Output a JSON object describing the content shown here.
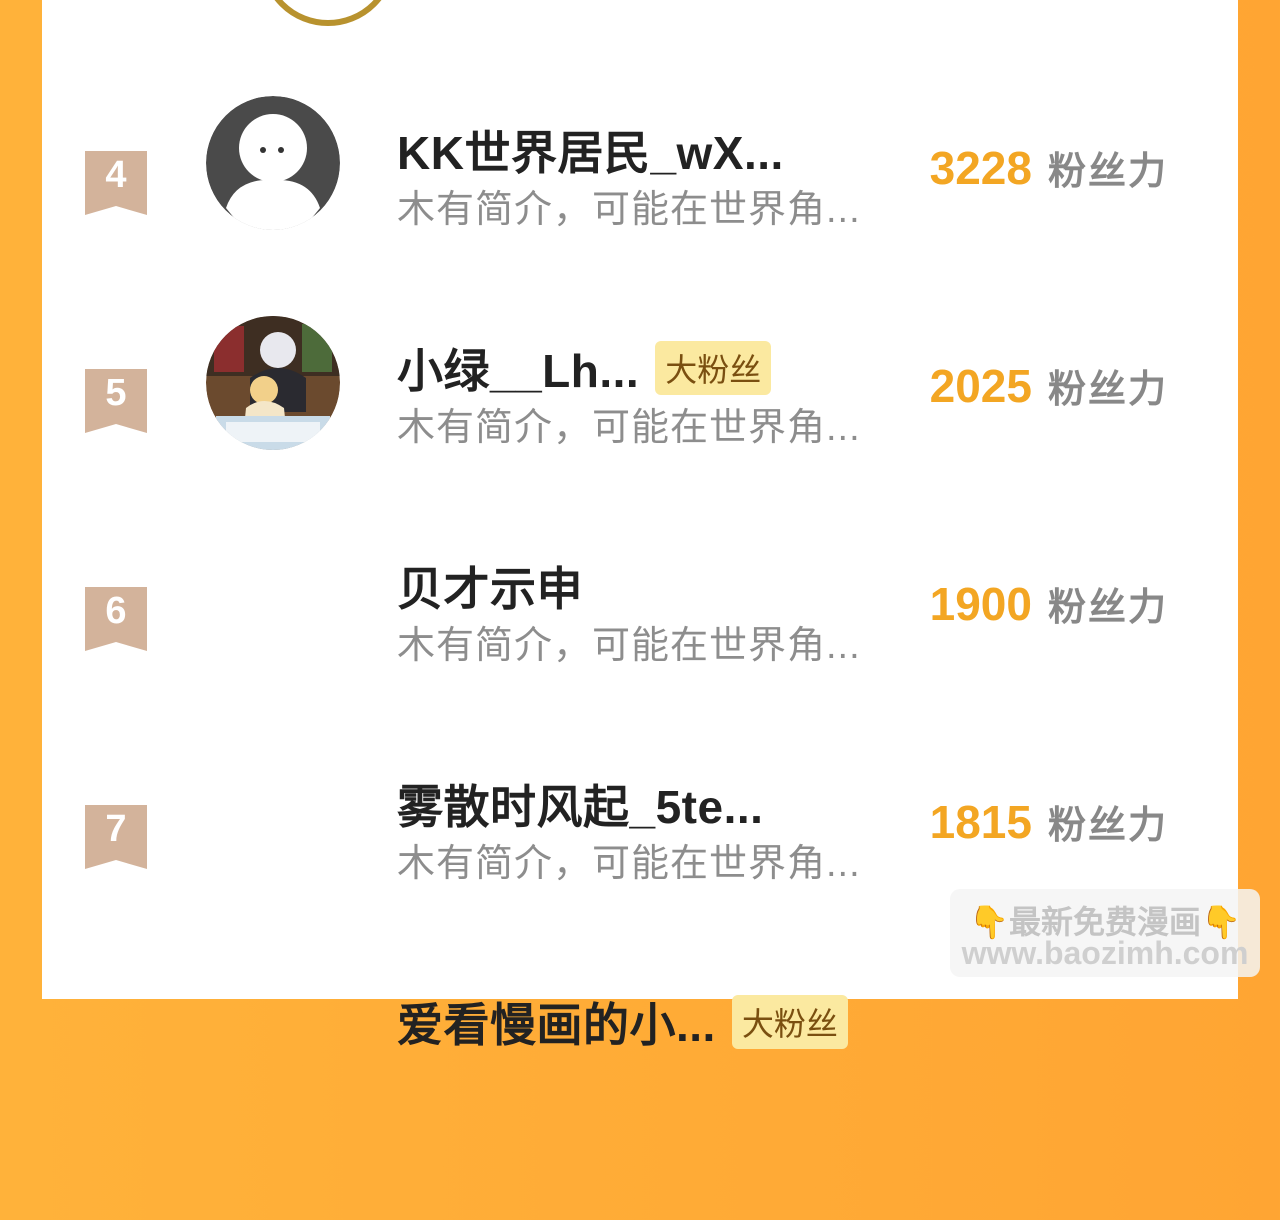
{
  "rows": [
    {
      "rank": "4",
      "name": "KK世界居民_wX...",
      "badge": "",
      "bio": "木有简介，可能在世界角...",
      "score": "3228",
      "unit": "粉丝力"
    },
    {
      "rank": "5",
      "name": "小绿__Lh...",
      "badge": "大粉丝",
      "bio": "木有简介，可能在世界角...",
      "score": "2025",
      "unit": "粉丝力"
    },
    {
      "rank": "6",
      "name": "贝才示申",
      "badge": "",
      "bio": "木有简介，可能在世界角...",
      "score": "1900",
      "unit": "粉丝力"
    },
    {
      "rank": "7",
      "name": "雾散时风起_5te...",
      "badge": "",
      "bio": "木有简介，可能在世界角...",
      "score": "1815",
      "unit": "粉丝力"
    },
    {
      "rank": "",
      "name": "爱看慢画的小...",
      "badge": "大粉丝",
      "bio": "",
      "score": "",
      "unit": ""
    }
  ],
  "watermark": {
    "hand_icon": "👇",
    "line1": "最新免费漫画",
    "line2": "www.baozimh.com"
  },
  "colors": {
    "accent": "#f3a623",
    "rank_badge": "#d3b39b",
    "background": "#ffa533"
  }
}
